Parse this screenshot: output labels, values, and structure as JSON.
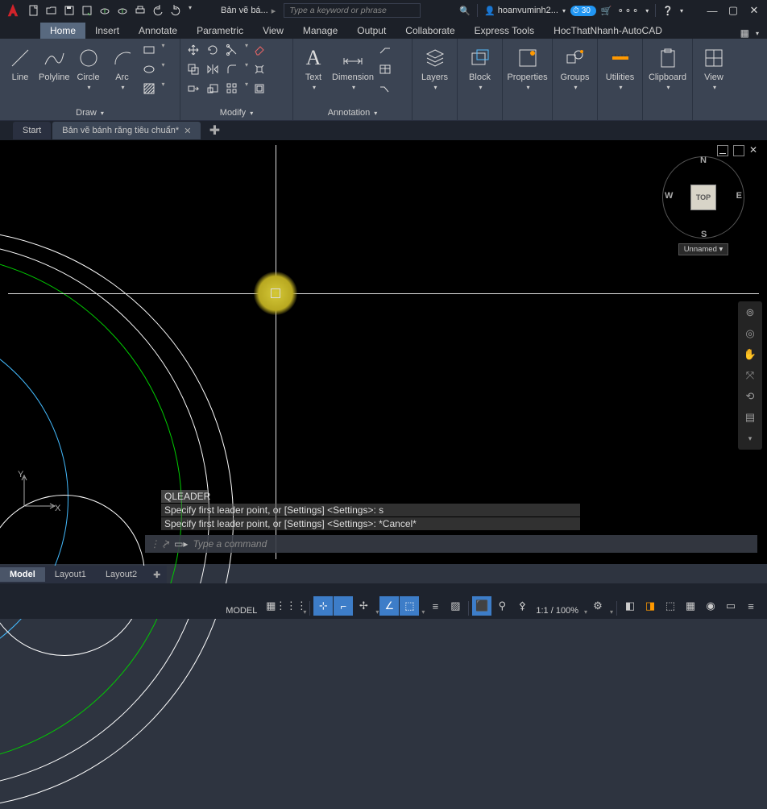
{
  "title": "Bản vẽ bá...",
  "search_placeholder": "Type a keyword or phrase",
  "user": "hoanvuminh2...",
  "badge": "30",
  "ribbon_tabs": [
    "Home",
    "Insert",
    "Annotate",
    "Parametric",
    "View",
    "Manage",
    "Output",
    "Collaborate",
    "Express Tools",
    "HocThatNhanh-AutoCAD"
  ],
  "panels": {
    "draw": {
      "title": "Draw",
      "items": [
        "Line",
        "Polyline",
        "Circle",
        "Arc"
      ]
    },
    "modify": {
      "title": "Modify"
    },
    "annotation": {
      "title": "Annotation",
      "items": [
        "Text",
        "Dimension"
      ]
    },
    "layers": "Layers",
    "block": "Block",
    "properties": "Properties",
    "groups": "Groups",
    "utilities": "Utilities",
    "clipboard": "Clipboard",
    "view": "View"
  },
  "doc_tabs": {
    "start": "Start",
    "active": "Bản vẽ bánh răng tiêu chuẩn*"
  },
  "viewcube": {
    "top": "TOP",
    "n": "N",
    "s": "S",
    "e": "E",
    "w": "W",
    "unnamed": "Unnamed"
  },
  "cmd": {
    "label": "QLEADER",
    "line1": "Specify first leader point, or [Settings] <Settings>: s",
    "line2": "Specify first leader point, or [Settings] <Settings>: *Cancel*",
    "prompt": "Type a command"
  },
  "layout_tabs": [
    "Model",
    "Layout1",
    "Layout2"
  ],
  "status": {
    "model": "MODEL",
    "zoom": "1:1 / 100%"
  }
}
